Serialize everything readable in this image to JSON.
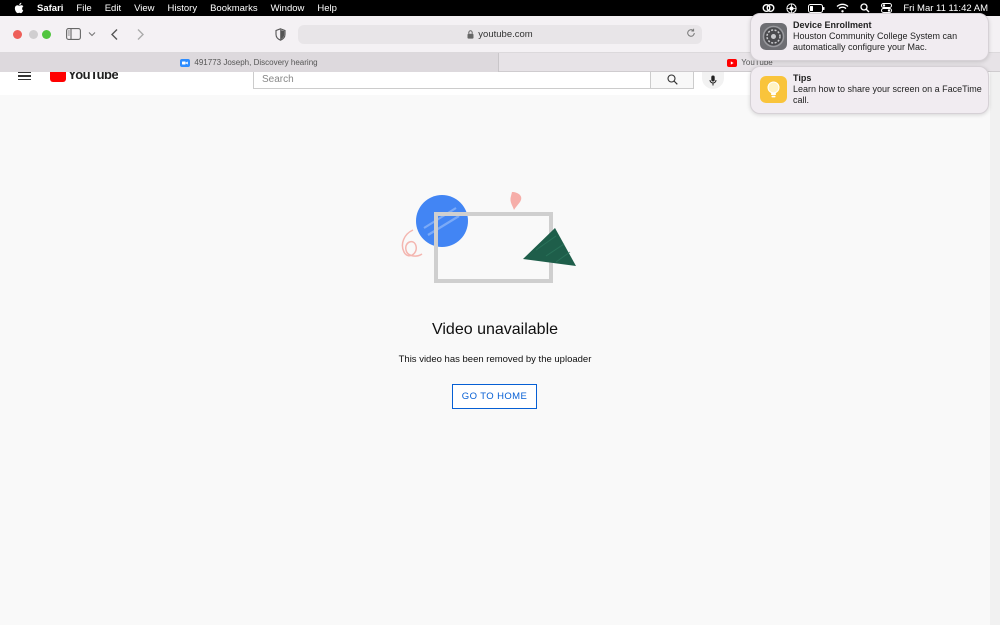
{
  "menubar": {
    "app": "Safari",
    "items": [
      "File",
      "Edit",
      "View",
      "History",
      "Bookmarks",
      "Window",
      "Help"
    ],
    "clock": "Fri Mar 11  11:42 AM"
  },
  "toolbar": {
    "url": "youtube.com"
  },
  "tabs": [
    {
      "label": "491773 Joseph, Discovery hearing",
      "icon": "zoom-icon",
      "color": "#2d8cff"
    },
    {
      "label": "YouTube",
      "icon": "youtube-icon",
      "color": "#ff0000"
    }
  ],
  "youtube": {
    "logo_text": "YouTube",
    "search_placeholder": "Search"
  },
  "main": {
    "title": "Video unavailable",
    "subtitle": "This video has been removed by the uploader",
    "button_label": "GO TO HOME"
  },
  "notifications": [
    {
      "title": "Device Enrollment",
      "body": "Houston Community College System can automatically configure your Mac.",
      "icon": "system-preferences-icon"
    },
    {
      "title": "Tips",
      "body": "Learn how to share your screen on a FaceTime call.",
      "icon": "tips-icon"
    }
  ],
  "colors": {
    "accent": "#065fd4",
    "youtube_red": "#ff0000"
  }
}
